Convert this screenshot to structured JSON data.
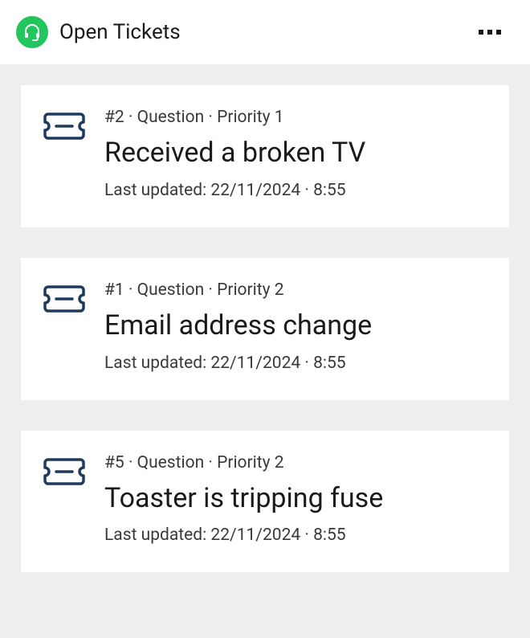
{
  "header": {
    "title": "Open Tickets"
  },
  "tickets": [
    {
      "meta": "#2 · Question · Priority 1",
      "title": "Received a broken TV",
      "updated": "Last updated: 22/11/2024 · 8:55"
    },
    {
      "meta": "#1 · Question · Priority 2",
      "title": "Email address change",
      "updated": "Last updated: 22/11/2024 · 8:55"
    },
    {
      "meta": "#5 · Question · Priority 2",
      "title": "Toaster is tripping fuse",
      "updated": "Last updated: 22/11/2024 · 8:55"
    }
  ]
}
